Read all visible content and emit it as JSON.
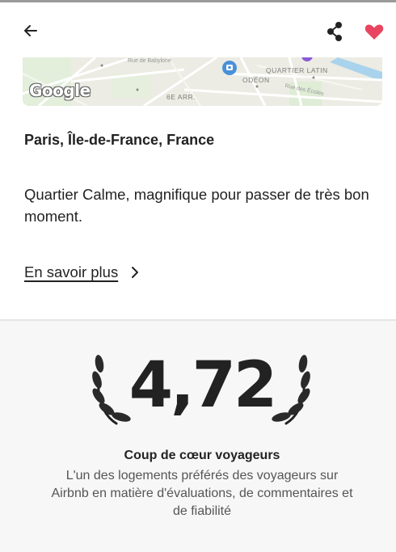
{
  "header": {
    "back_icon": "arrow-left-icon",
    "share_icon": "share-icon",
    "favorite_icon": "heart-icon",
    "favorite_color": "#e94560"
  },
  "map": {
    "logo": "Google",
    "labels": {
      "rue_babylone": "Rue de Babylone",
      "quartier_latin": "QUARTIER LATIN",
      "odeon": "ODÉON",
      "arr": "6E ARR.",
      "rue_ecoles": "Rue des Écoles"
    }
  },
  "listing": {
    "location": "Paris, Île-de-France, France",
    "description": "Quartier Calme, magnifique pour passer de très bon moment.",
    "learn_more": "En savoir plus"
  },
  "rating": {
    "value": "4,72",
    "title": "Coup de cœur voyageurs",
    "description": "L'un des logements préférés des voyageurs sur Airbnb en matière d'évaluations, de commentaires et de fiabilité"
  }
}
